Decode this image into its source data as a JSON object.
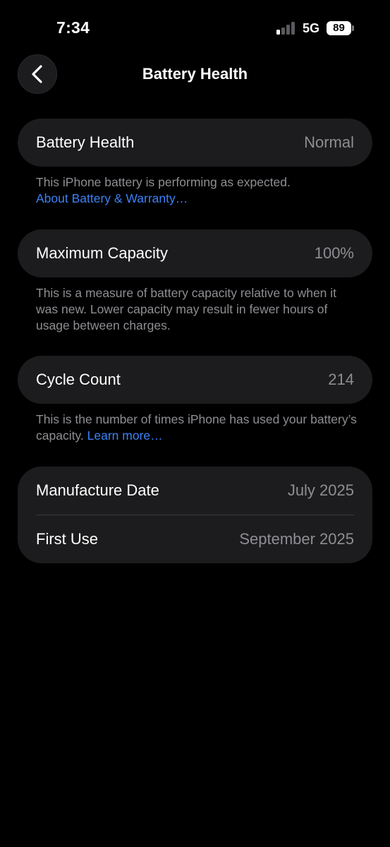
{
  "status_bar": {
    "time": "7:34",
    "network": "5G",
    "battery_level": "89",
    "signal_bars_active": 1,
    "signal_bars_total": 4
  },
  "nav": {
    "back_icon": "chevron-left-icon",
    "title": "Battery Health"
  },
  "battery_health": {
    "label": "Battery Health",
    "value": "Normal",
    "footnote": "This iPhone battery is performing as expected.",
    "link": "About Battery & Warranty…"
  },
  "maximum_capacity": {
    "label": "Maximum Capacity",
    "value": "100%",
    "footnote": "This is a measure of battery capacity relative to when it was new. Lower capacity may result in fewer hours of usage between charges."
  },
  "cycle_count": {
    "label": "Cycle Count",
    "value": "214",
    "footnote": "This is the number of times iPhone has used your battery’s capacity.",
    "link": "Learn more…"
  },
  "dates": {
    "manufacture_label": "Manufacture Date",
    "manufacture_value": "July 2025",
    "first_use_label": "First Use",
    "first_use_value": "September 2025"
  },
  "colors": {
    "background": "#000000",
    "card": "#1c1c1e",
    "secondary_text": "#8e8e93",
    "link": "#3b82f6"
  }
}
